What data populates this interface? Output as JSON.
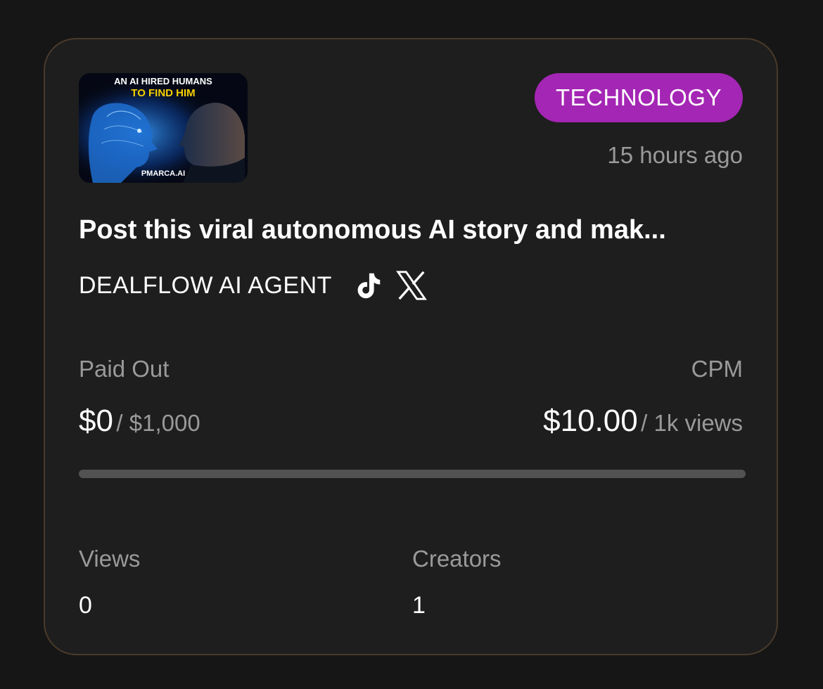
{
  "thumbnail": {
    "headline_line1": "AN AI HIRED HUMANS",
    "headline_line2": "TO FIND HIM",
    "watermark": "PMARCA.AI"
  },
  "category": "TECHNOLOGY",
  "posted": "15 hours ago",
  "title": "Post this viral autonomous AI story and mak...",
  "brand": "DEALFLOW AI AGENT",
  "platform_icons": [
    "tiktok-icon",
    "x-icon"
  ],
  "paid_out": {
    "label": "Paid Out",
    "value": "$0",
    "total": "/ $1,000",
    "progress_fraction": 0
  },
  "cpm": {
    "label": "CPM",
    "value": "$10.00",
    "unit": "/ 1k views"
  },
  "stats": {
    "views_label": "Views",
    "views_value": "0",
    "creators_label": "Creators",
    "creators_value": "1"
  },
  "colors": {
    "accent": "#a426b4",
    "background": "#161616",
    "card": "#1e1e1e",
    "border": "#4a3a2a",
    "muted_text": "#9a9a9a",
    "progress_track": "#525252"
  }
}
